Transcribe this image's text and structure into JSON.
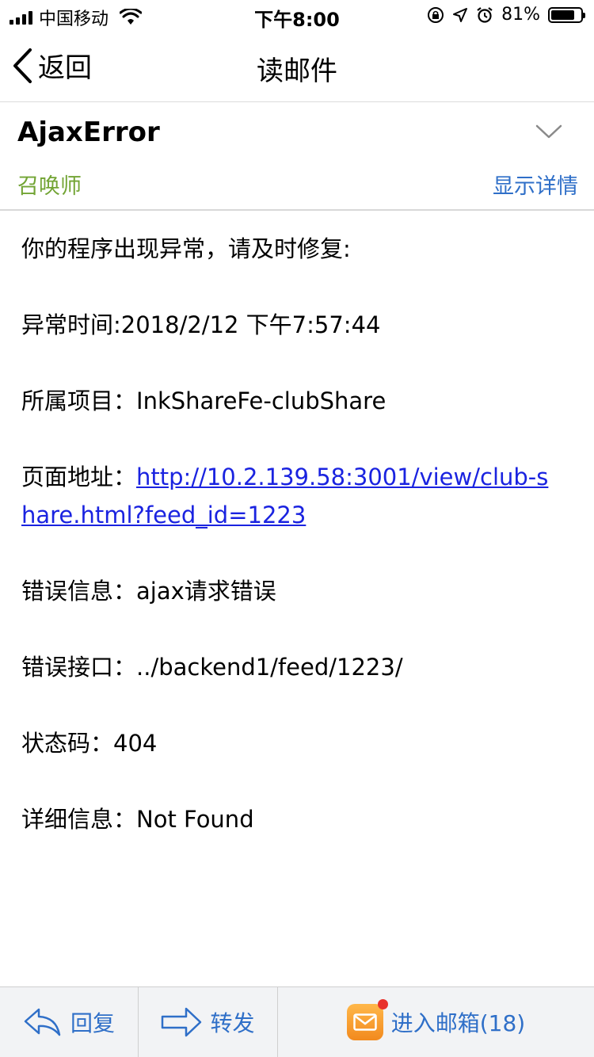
{
  "status_bar": {
    "carrier": "中国移动",
    "time": "下午8:00",
    "battery_percent": "81%",
    "battery_level": 0.81,
    "icons": [
      "signal-icon",
      "wifi-icon",
      "orientation-lock-icon",
      "location-icon",
      "alarm-icon",
      "battery-icon"
    ]
  },
  "nav": {
    "back_label": "返回",
    "title": "读邮件"
  },
  "mail": {
    "subject": "AjaxError",
    "sender": "召唤师",
    "show_details_label": "显示详情",
    "colors": {
      "sender": "#72a434",
      "link": "#1a23e0",
      "accent": "#2f6fc8"
    }
  },
  "body": {
    "intro": "你的程序出现异常，请及时修复:",
    "time_line": "异常时间:2018/2/12 下午7:57:44",
    "project_label": "所属项目：",
    "project_value": "InkShareFe-clubShare",
    "url_label": "页面地址：",
    "url_value": "http://10.2.139.58:3001/view/club-share.html?feed_id=1223",
    "error_label": "错误信息：",
    "error_value": "ajax请求错误",
    "endpoint_label": "错误接口：",
    "endpoint_value": "../backend1/feed/1223/",
    "status_label": "状态码：",
    "status_value": "404",
    "detail_label": "详细信息：",
    "detail_value": "Not Found"
  },
  "toolbar": {
    "reply_label": "回复",
    "forward_label": "转发",
    "inbox_label": "进入邮箱(18)"
  }
}
